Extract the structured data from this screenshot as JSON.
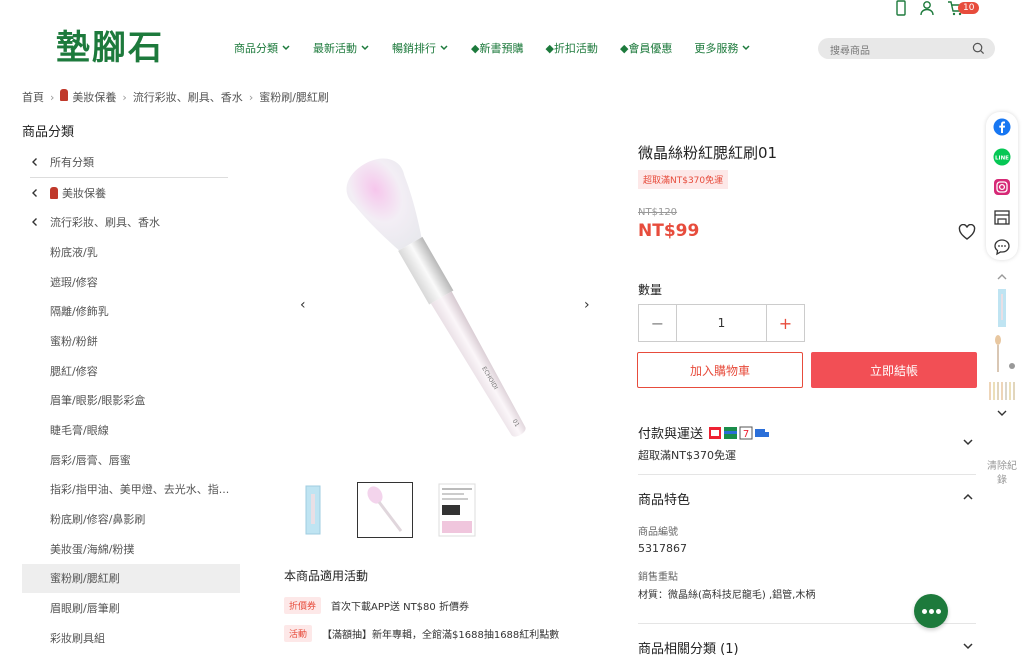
{
  "brand": {
    "logo": "墊腳石",
    "color": "#1d7a3c"
  },
  "nav": [
    "商品分類",
    "最新活動",
    "暢銷排行",
    "◆新書預購",
    "◆折扣活動",
    "◆會員優惠",
    "更多服務"
  ],
  "search": {
    "placeholder": "搜尋商品"
  },
  "cart": {
    "count": "10"
  },
  "breadcrumb": [
    "首頁",
    "美妝保養",
    "流行彩妝、刷具、香水",
    "蜜粉刷/腮紅刷"
  ],
  "sidebar": {
    "title": "商品分類",
    "back_items": [
      "所有分類",
      "美妝保養",
      "流行彩妝、刷具、香水"
    ],
    "items": [
      "粉底液/乳",
      "遮瑕/修容",
      "隔離/修飾乳",
      "蜜粉/粉餅",
      "腮紅/修容",
      "眉筆/眼影/眼影彩盒",
      "睫毛膏/眼線",
      "唇彩/唇膏、唇蜜",
      "指彩/指甲油、美甲燈、去光水、指...",
      "粉底刷/修容/鼻影刷",
      "美妝蛋/海綿/粉撲",
      "蜜粉刷/腮紅刷",
      "眉眼刷/唇筆刷",
      "彩妝刷具組"
    ],
    "active_index": 11
  },
  "gallery": {
    "prev": "‹",
    "next": "›",
    "brush_text": "ECHOIDI",
    "brush_num": "01"
  },
  "promotions": {
    "title": "本商品適用活動",
    "list": [
      {
        "tag": "折價券",
        "text": "首次下載APP送 NT$80 折價券"
      },
      {
        "tag": "活動",
        "text": "【滿額抽】新年專輯，全館滿$1688抽1688紅利點數"
      }
    ]
  },
  "product": {
    "title": "微晶絲粉紅腮紅刷01",
    "ship_tag": "超取滿NT$370免運",
    "old_price": "NT$120",
    "price": "NT$99",
    "qty_label": "數量",
    "qty": "1",
    "add_cart": "加入購物車",
    "buy_now": "立即結帳"
  },
  "sections": {
    "payment_title": "付款與運送",
    "payment_note": "超取滿NT$370免運",
    "feature_title": "商品特色",
    "sku_label": "商品編號",
    "sku": "5317867",
    "selling_label": "銷售重點",
    "selling": "材質：微晶絲(高科技尼龍毛) ,鋁管,木柄",
    "related_title": "商品相關分類 (1)"
  },
  "recent": {
    "clear": "清除紀錄"
  }
}
